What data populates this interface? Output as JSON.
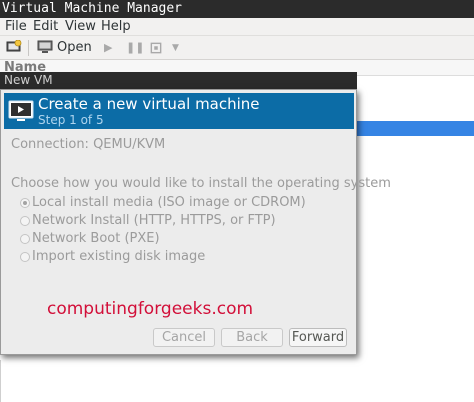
{
  "window": {
    "title": "Virtual Machine Manager"
  },
  "menu": [
    "File",
    "Edit",
    "View",
    "Help"
  ],
  "toolbar": {
    "open_label": "Open"
  },
  "list": {
    "column_header": "Name"
  },
  "dialog": {
    "title": "New VM",
    "banner_title": "Create a new virtual machine",
    "banner_step": "Step 1 of 5",
    "connection": "Connection: QEMU/KVM",
    "question": "Choose how you would like to install the operating system",
    "options": [
      {
        "label": "Local install media (ISO image or CDROM)",
        "selected": true
      },
      {
        "label": "Network Install (HTTP, HTTPS, or FTP)",
        "selected": false
      },
      {
        "label": "Network Boot (PXE)",
        "selected": false
      },
      {
        "label": "Import existing disk image",
        "selected": false
      }
    ],
    "buttons": {
      "cancel": "Cancel",
      "back": "Back",
      "forward": "Forward"
    }
  },
  "watermark": "computingforgeeks.com",
  "colors": {
    "banner": "#0c6ca6",
    "selection": "#3584e4",
    "watermark": "#d20f39"
  }
}
